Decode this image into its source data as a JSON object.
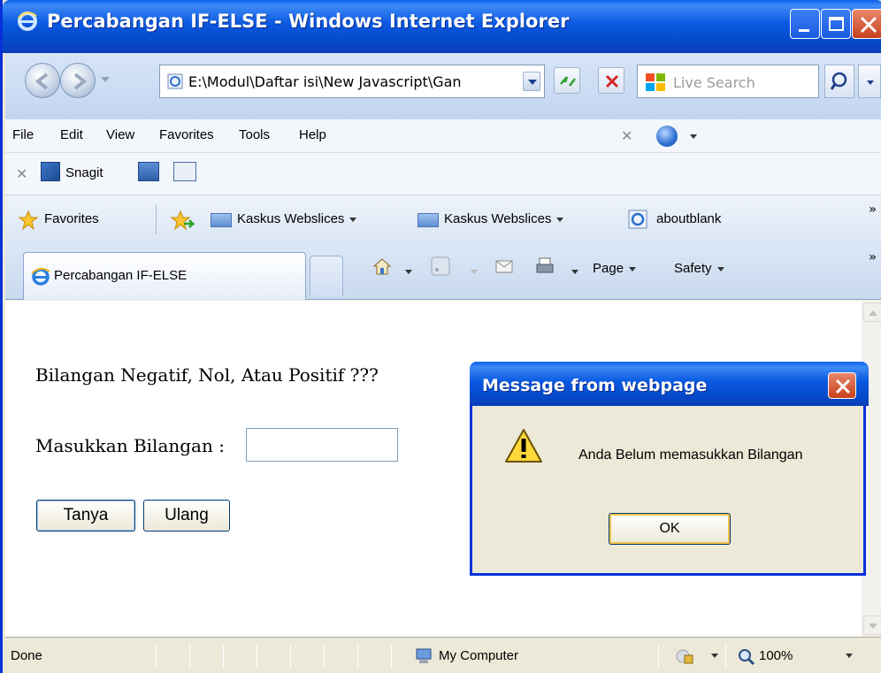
{
  "window": {
    "title": "Percabangan IF-ELSE - Windows Internet Explorer"
  },
  "navbar": {
    "url": "E:\\Modul\\Daftar isi\\New Javascript\\Gan",
    "search_placeholder": "Live Search"
  },
  "menu": {
    "items": [
      "File",
      "Edit",
      "View",
      "Favorites",
      "Tools",
      "Help"
    ]
  },
  "links_toolbar": {
    "snagit_label": "Snagit"
  },
  "favorites_bar": {
    "favorites_label": "Favorites",
    "links": [
      "Kaskus Webslices",
      "Kaskus Webslices",
      "aboutblank"
    ]
  },
  "tabs": {
    "active_tab": "Percabangan IF-ELSE",
    "page_label": "Page",
    "safety_label": "Safety"
  },
  "page": {
    "heading": "Bilangan Negatif, Nol, Atau Positif ???",
    "input_label": "Masukkan Bilangan :",
    "input_value": "",
    "ask_button": "Tanya",
    "reset_button": "Ulang"
  },
  "dialog": {
    "title": "Message from webpage",
    "message": "Anda Belum memasukkan Bilangan",
    "ok_button": "OK"
  },
  "statusbar": {
    "status": "Done",
    "zone": "My Computer",
    "zoom": "100%"
  },
  "icons": [
    "ie-logo-icon",
    "back-icon",
    "forward-icon",
    "refresh-icon",
    "stop-icon",
    "live-search-icon",
    "search-icon",
    "favorites-star-icon",
    "add-favorites-icon",
    "webslice-icon",
    "home-icon",
    "feeds-icon",
    "mail-icon",
    "print-icon",
    "warning-icon",
    "close-icon",
    "my-computer-icon",
    "zoom-icon"
  ]
}
